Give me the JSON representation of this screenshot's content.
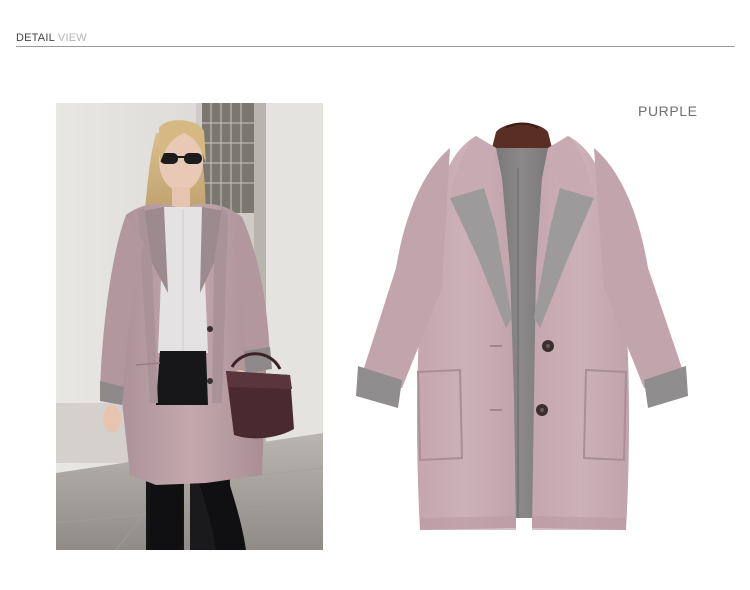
{
  "header": {
    "title_strong": "DETAIL",
    "title_soft": "VIEW"
  },
  "product": {
    "color_name": "PURPLE",
    "coat_color": "#c7a9b1",
    "lining_color": "#7d7b7c",
    "collar_color": "#9c9a9b"
  },
  "images": {
    "model_photo": "model-wearing-coat",
    "product_photo": "coat-flat-lay"
  }
}
